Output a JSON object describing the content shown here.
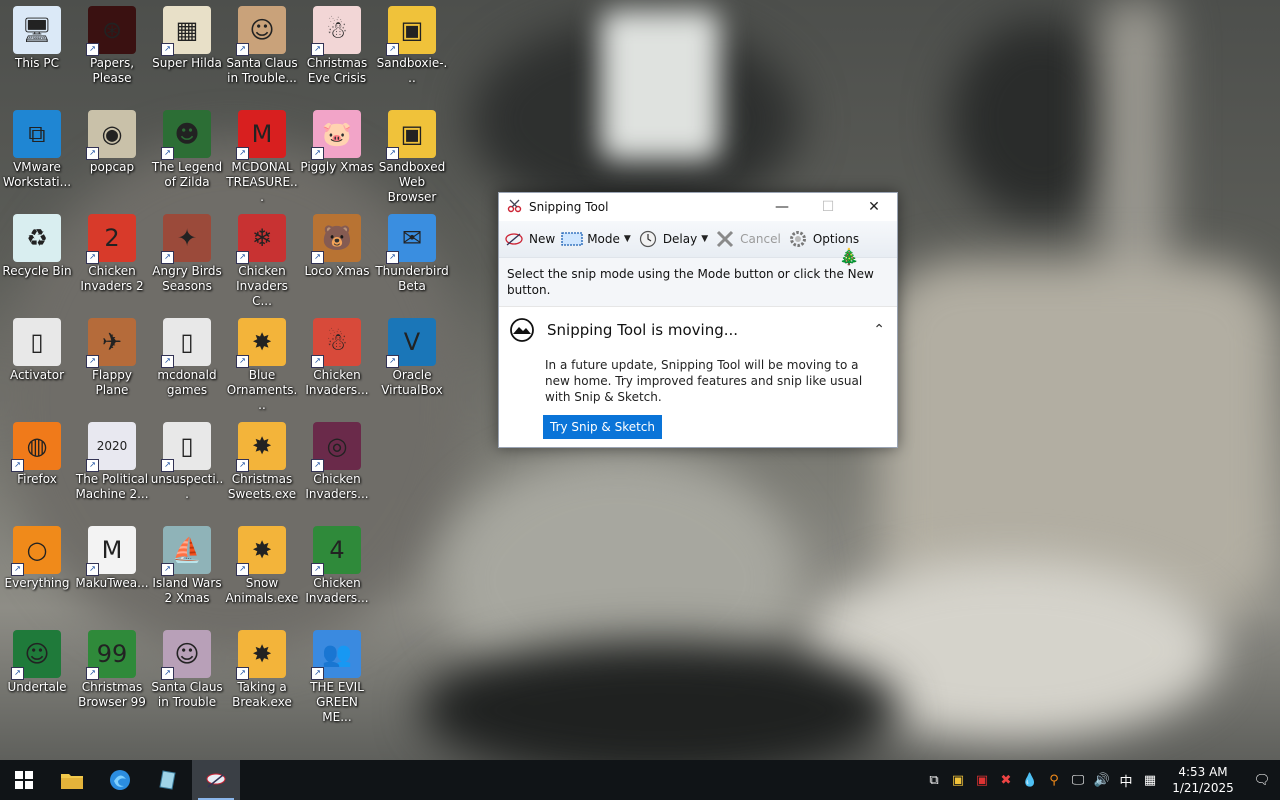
{
  "desktop": {
    "icons": [
      {
        "label": "This PC",
        "col": 0,
        "row": 0,
        "color": "#dbe9f7",
        "glyph": "🖥"
      },
      {
        "label": "Papers, Please",
        "col": 1,
        "row": 0,
        "color": "#3a1111",
        "glyph": "⊛"
      },
      {
        "label": "Super Hilda",
        "col": 2,
        "row": 0,
        "color": "#e8e0c8",
        "glyph": "▦"
      },
      {
        "label": "Santa Claus in Trouble...",
        "col": 3,
        "row": 0,
        "color": "#c9a27a",
        "glyph": "☺"
      },
      {
        "label": "Christmas Eve Crisis",
        "col": 4,
        "row": 0,
        "color": "#f2d6d6",
        "glyph": "☃"
      },
      {
        "label": "Sandboxie-...",
        "col": 5,
        "row": 0,
        "color": "#f0c23a",
        "glyph": "▣"
      },
      {
        "label": "VMware Workstati...",
        "col": 0,
        "row": 1,
        "color": "#1f86d3",
        "glyph": "⧉"
      },
      {
        "label": "popcap",
        "col": 1,
        "row": 1,
        "color": "#c9c1a9",
        "glyph": "◉"
      },
      {
        "label": "The Legend of Zilda",
        "col": 2,
        "row": 1,
        "color": "#2c6e35",
        "glyph": "☻"
      },
      {
        "label": "MCDONAL TREASURE...",
        "col": 3,
        "row": 1,
        "color": "#d81f1f",
        "glyph": "M"
      },
      {
        "label": "Piggly Xmas",
        "col": 4,
        "row": 1,
        "color": "#f2a4c8",
        "glyph": "🐷"
      },
      {
        "label": "Sandboxed Web Browser",
        "col": 5,
        "row": 1,
        "color": "#f0c23a",
        "glyph": "▣"
      },
      {
        "label": "Recycle Bin",
        "col": 0,
        "row": 2,
        "color": "#d9eef0",
        "glyph": "♻"
      },
      {
        "label": "Chicken Invaders 2",
        "col": 1,
        "row": 2,
        "color": "#d83a2a",
        "glyph": "2"
      },
      {
        "label": "Angry Birds Seasons",
        "col": 2,
        "row": 2,
        "color": "#9b4a3a",
        "glyph": "✦"
      },
      {
        "label": "Chicken Invaders C...",
        "col": 3,
        "row": 2,
        "color": "#c83232",
        "glyph": "❄"
      },
      {
        "label": "Loco Xmas",
        "col": 4,
        "row": 2,
        "color": "#b87333",
        "glyph": "🐻"
      },
      {
        "label": "Thunderbird Beta",
        "col": 5,
        "row": 2,
        "color": "#3a8ee0",
        "glyph": "✉"
      },
      {
        "label": "Activator",
        "col": 0,
        "row": 3,
        "color": "#e8e8e8",
        "glyph": "▯"
      },
      {
        "label": "Flappy Plane",
        "col": 1,
        "row": 3,
        "color": "#b56b3a",
        "glyph": "✈"
      },
      {
        "label": "mcdonald games",
        "col": 2,
        "row": 3,
        "color": "#e8e8e8",
        "glyph": "▯"
      },
      {
        "label": "Blue Ornaments...",
        "col": 3,
        "row": 3,
        "color": "#f3b43a",
        "glyph": "✸"
      },
      {
        "label": "Chicken Invaders...",
        "col": 4,
        "row": 3,
        "color": "#d84a3a",
        "glyph": "☃"
      },
      {
        "label": "Oracle VirtualBox",
        "col": 5,
        "row": 3,
        "color": "#1a76b8",
        "glyph": "V"
      },
      {
        "label": "Firefox",
        "col": 0,
        "row": 4,
        "color": "#f07a1a",
        "glyph": "◍"
      },
      {
        "label": "The Political Machine 2...",
        "col": 1,
        "row": 4,
        "color": "#e8e8f0",
        "glyph": "2020"
      },
      {
        "label": "unsuspecti...",
        "col": 2,
        "row": 4,
        "color": "#e8e8e8",
        "glyph": "▯"
      },
      {
        "label": "Christmas Sweets.exe",
        "col": 3,
        "row": 4,
        "color": "#f3b43a",
        "glyph": "✸"
      },
      {
        "label": "Chicken Invaders...",
        "col": 4,
        "row": 4,
        "color": "#6a2a4a",
        "glyph": "◎"
      },
      {
        "label": "Everything",
        "col": 0,
        "row": 5,
        "color": "#f08a1a",
        "glyph": "○"
      },
      {
        "label": "MakuTwea...",
        "col": 1,
        "row": 5,
        "color": "#f3f3f3",
        "glyph": "M"
      },
      {
        "label": "Island Wars 2 Xmas",
        "col": 2,
        "row": 5,
        "color": "#8fb3b8",
        "glyph": "⛵"
      },
      {
        "label": "Snow Animals.exe",
        "col": 3,
        "row": 5,
        "color": "#f3b43a",
        "glyph": "✸"
      },
      {
        "label": "Chicken Invaders...",
        "col": 4,
        "row": 5,
        "color": "#2f8a3a",
        "glyph": "4"
      },
      {
        "label": "Undertale",
        "col": 0,
        "row": 6,
        "color": "#1f7a3a",
        "glyph": "☺"
      },
      {
        "label": "Christmas Browser 99",
        "col": 1,
        "row": 6,
        "color": "#2f8a3a",
        "glyph": "99"
      },
      {
        "label": "Santa Claus in Trouble",
        "col": 2,
        "row": 6,
        "color": "#b8a0b8",
        "glyph": "☺"
      },
      {
        "label": "Taking a Break.exe",
        "col": 3,
        "row": 6,
        "color": "#f3b43a",
        "glyph": "✸"
      },
      {
        "label": "THE EVIL GREEN ME...",
        "col": 4,
        "row": 6,
        "color": "#3a8ae0",
        "glyph": "👥"
      }
    ]
  },
  "snipping_tool": {
    "title": "Snipping Tool",
    "buttons": {
      "new": "New",
      "mode": "Mode",
      "delay": "Delay",
      "cancel": "Cancel",
      "options": "Options"
    },
    "hint": "Select the snip mode using the Mode button or click the New button.",
    "notice_title": "Snipping Tool is moving...",
    "notice_body": "In a future update, Snipping Tool will be moving to a new home. Try improved features and snip like usual with Snip & Sketch.",
    "try_button": "Try Snip & Sketch"
  },
  "taskbar": {
    "time": "4:53 AM",
    "date": "1/21/2025",
    "ime": "中"
  }
}
